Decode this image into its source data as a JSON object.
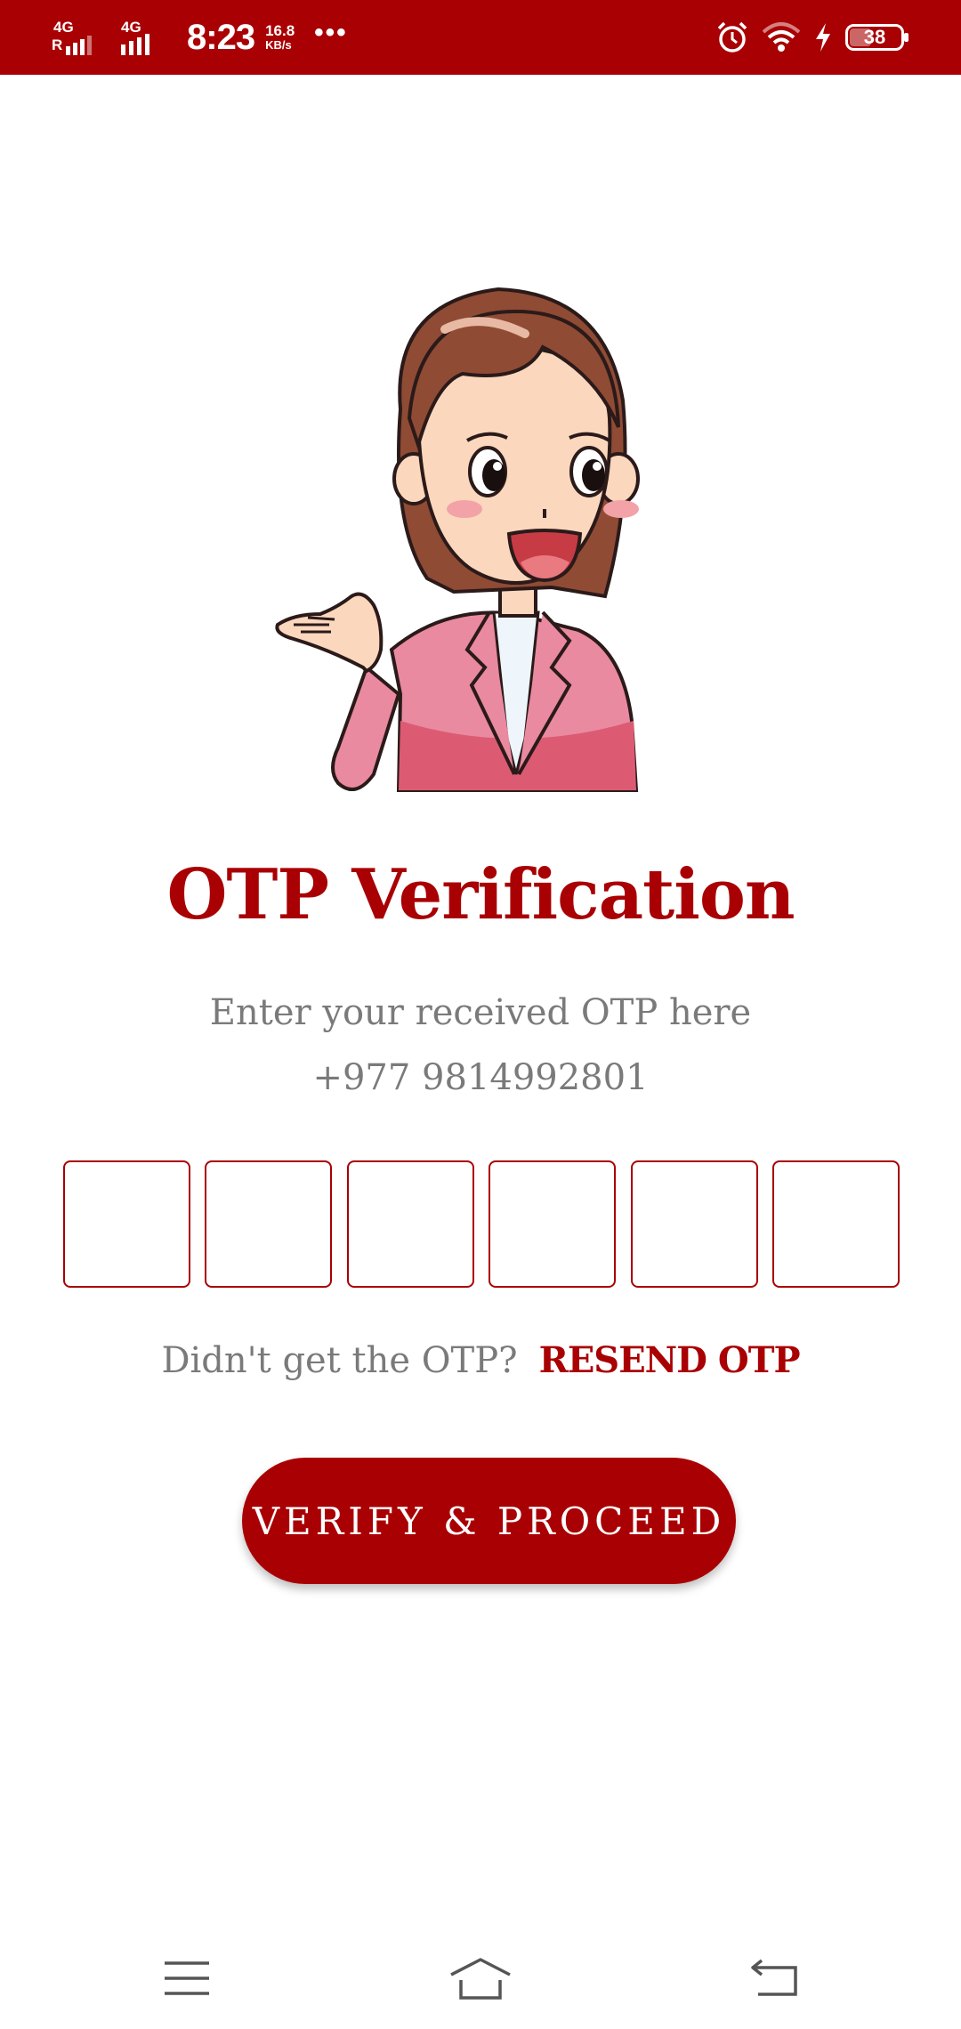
{
  "status_bar": {
    "network1_label": "4G",
    "network1_roaming": "R",
    "network2_label": "4G",
    "time": "8:23",
    "speed_value": "16.8",
    "speed_unit": "KB/s",
    "overflow_dots": "•••",
    "battery_level": "38",
    "icons": [
      "signal-icon",
      "signal-icon",
      "alarm-icon",
      "wifi-icon",
      "charging-icon",
      "battery-icon"
    ]
  },
  "illustration": {
    "icon": "woman-presenting-illustration"
  },
  "page": {
    "title": "OTP Verification",
    "subtitle": "Enter your received OTP here",
    "phone_number": "+977 9814992801"
  },
  "otp": {
    "digits": [
      "",
      "",
      "",
      "",
      "",
      ""
    ]
  },
  "resend": {
    "question": "Didn't get the OTP?",
    "link_label": "RESEND OTP"
  },
  "actions": {
    "verify_label": "VERIFY & PROCEED"
  },
  "nav": {
    "icons": [
      "menu-icon",
      "home-icon",
      "back-icon"
    ]
  },
  "colors": {
    "brand": "#a90003",
    "muted_text": "#7a7a7a",
    "background": "#ffffff"
  }
}
